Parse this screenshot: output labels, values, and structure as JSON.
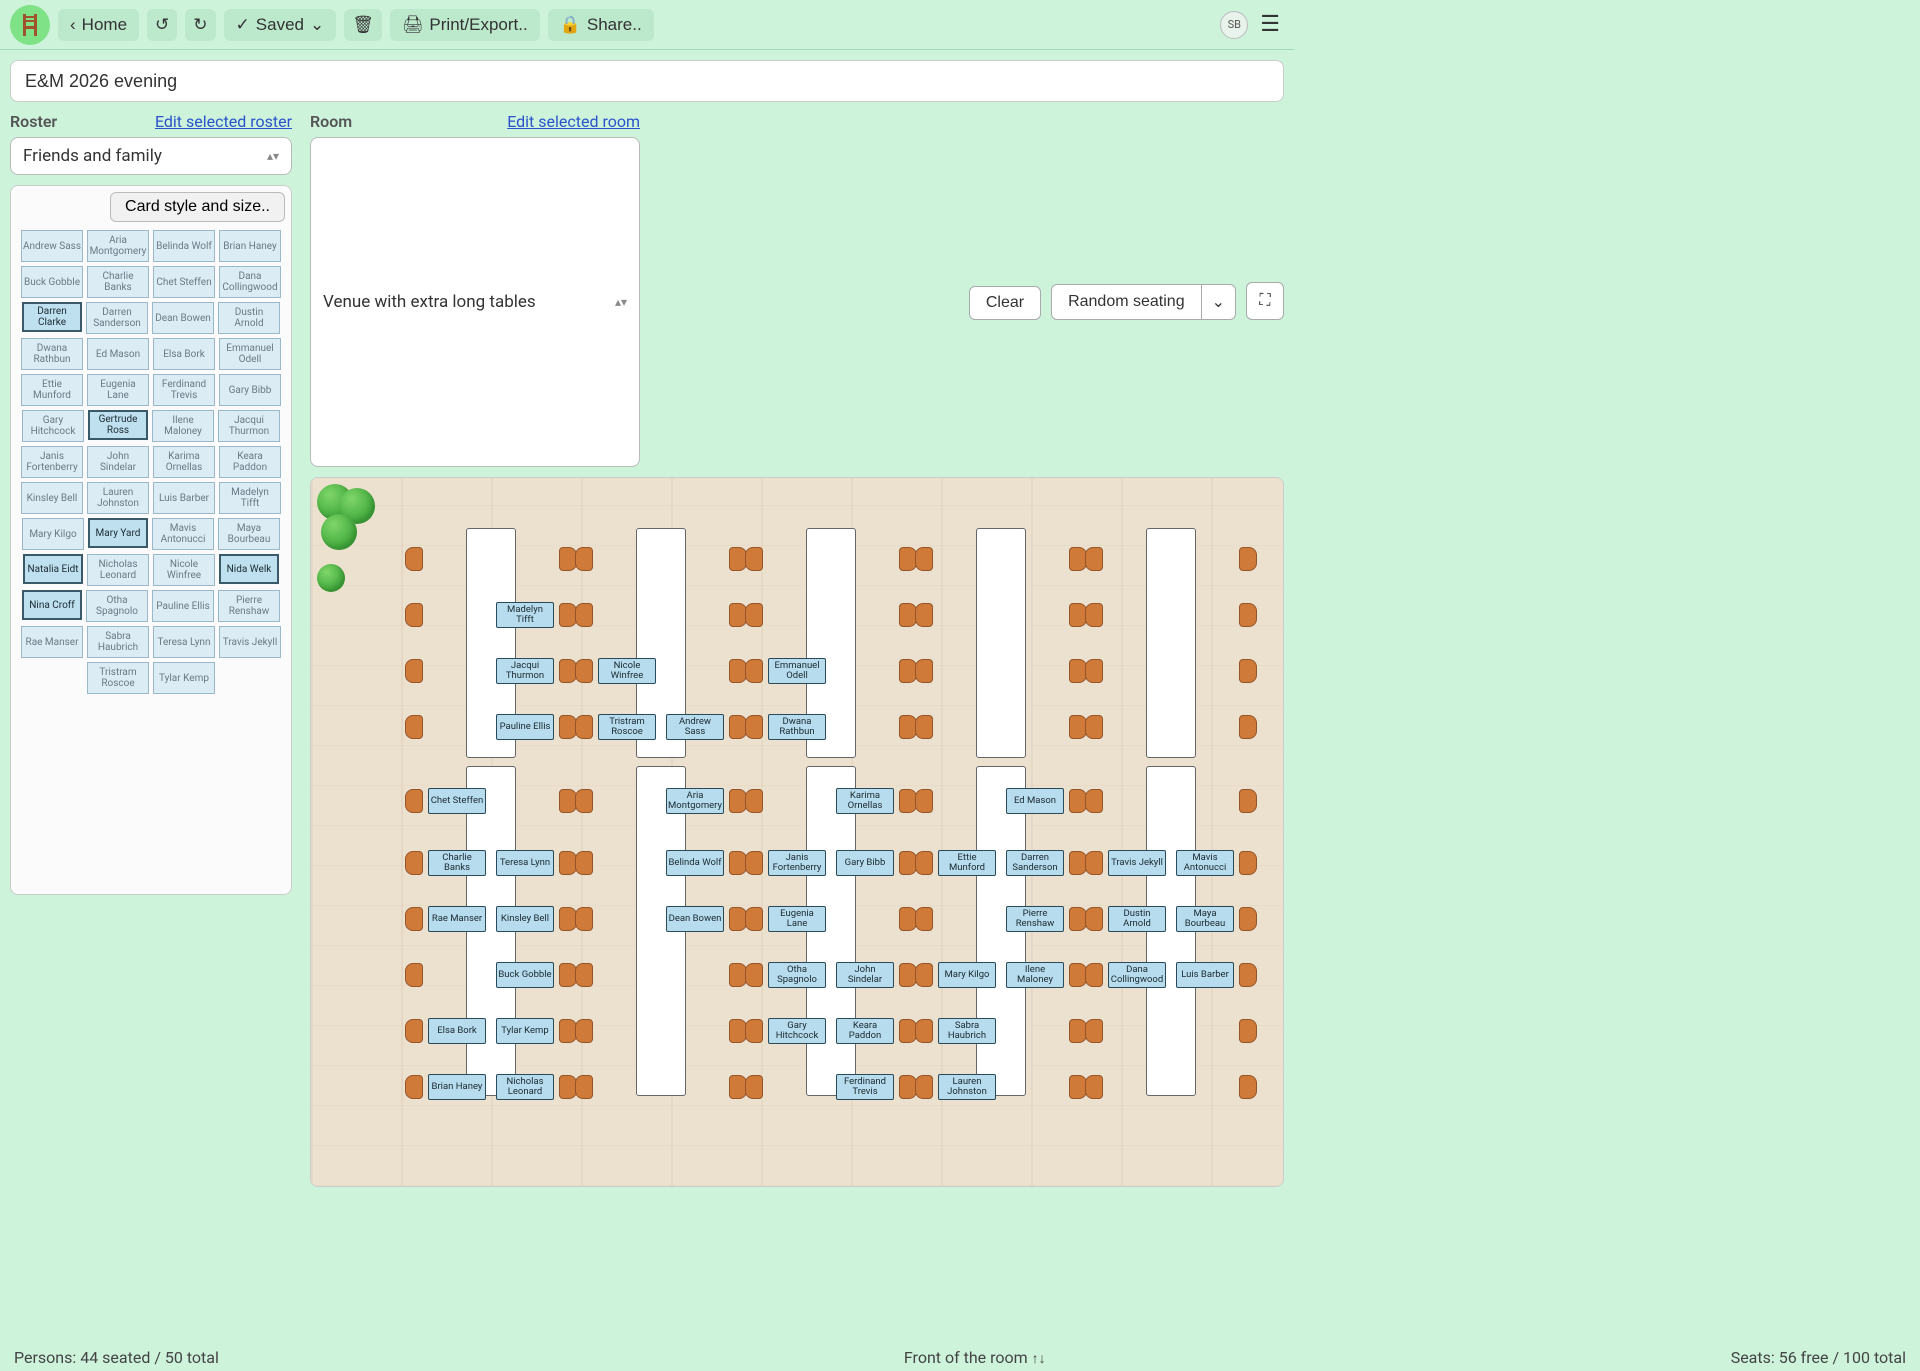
{
  "toolbar": {
    "home": "Home",
    "saved": "Saved",
    "print": "Print/Export..",
    "share": "Share..",
    "avatar": "SB"
  },
  "title": "E&M 2026 evening",
  "roster_label": "Roster",
  "roster_link": "Edit selected roster",
  "roster_selected": "Friends and family",
  "card_style_btn": "Card style and size..",
  "room_label": "Room",
  "room_link": "Edit selected room",
  "room_selected": "Venue with extra long tables",
  "clear_btn": "Clear",
  "random_btn": "Random seating",
  "roster": [
    {
      "name": "Andrew Sass",
      "seated": true
    },
    {
      "name": "Aria Montgomery",
      "seated": true
    },
    {
      "name": "Belinda Wolf",
      "seated": true
    },
    {
      "name": "Brian Haney",
      "seated": true
    },
    {
      "name": "Buck Gobble",
      "seated": true
    },
    {
      "name": "Charlie Banks",
      "seated": true
    },
    {
      "name": "Chet Steffen",
      "seated": true
    },
    {
      "name": "Dana Collingwood",
      "seated": true
    },
    {
      "name": "Darren Clarke",
      "seated": false
    },
    {
      "name": "Darren Sanderson",
      "seated": true
    },
    {
      "name": "Dean Bowen",
      "seated": true
    },
    {
      "name": "Dustin Arnold",
      "seated": true
    },
    {
      "name": "Dwana Rathbun",
      "seated": true
    },
    {
      "name": "Ed Mason",
      "seated": true
    },
    {
      "name": "Elsa Bork",
      "seated": true
    },
    {
      "name": "Emmanuel Odell",
      "seated": true
    },
    {
      "name": "Ettie Munford",
      "seated": true
    },
    {
      "name": "Eugenia Lane",
      "seated": true
    },
    {
      "name": "Ferdinand Trevis",
      "seated": true
    },
    {
      "name": "Gary Bibb",
      "seated": true
    },
    {
      "name": "Gary Hitchcock",
      "seated": true
    },
    {
      "name": "Gertrude Ross",
      "seated": false
    },
    {
      "name": "Ilene Maloney",
      "seated": true
    },
    {
      "name": "Jacqui Thurmon",
      "seated": true
    },
    {
      "name": "Janis Fortenberry",
      "seated": true
    },
    {
      "name": "John Sindelar",
      "seated": true
    },
    {
      "name": "Karima Ornellas",
      "seated": true
    },
    {
      "name": "Keara Paddon",
      "seated": true
    },
    {
      "name": "Kinsley Bell",
      "seated": true
    },
    {
      "name": "Lauren Johnston",
      "seated": true
    },
    {
      "name": "Luis Barber",
      "seated": true
    },
    {
      "name": "Madelyn Tifft",
      "seated": true
    },
    {
      "name": "Mary Kilgo",
      "seated": true
    },
    {
      "name": "Mary Yard",
      "seated": false
    },
    {
      "name": "Mavis Antonucci",
      "seated": true
    },
    {
      "name": "Maya Bourbeau",
      "seated": true
    },
    {
      "name": "Natalia Eidt",
      "seated": false
    },
    {
      "name": "Nicholas Leonard",
      "seated": true
    },
    {
      "name": "Nicole Winfree",
      "seated": true
    },
    {
      "name": "Nida Welk",
      "seated": false
    },
    {
      "name": "Nina Croff",
      "seated": false
    },
    {
      "name": "Otha Spagnolo",
      "seated": true
    },
    {
      "name": "Pauline Ellis",
      "seated": true
    },
    {
      "name": "Pierre Renshaw",
      "seated": true
    },
    {
      "name": "Rae Manser",
      "seated": true
    },
    {
      "name": "Sabra Haubrich",
      "seated": true
    },
    {
      "name": "Teresa Lynn",
      "seated": true
    },
    {
      "name": "Travis Jekyll",
      "seated": true
    },
    {
      "name": "Tristram Roscoe",
      "seated": true
    },
    {
      "name": "Tylar Kemp",
      "seated": true
    }
  ],
  "tables": [
    {
      "seats": [
        {
          "left": null,
          "right": null
        },
        {
          "left": null,
          "right": "Madelyn Tifft"
        },
        {
          "left": null,
          "right": "Jacqui Thurmon"
        },
        {
          "left": null,
          "right": "Pauline Ellis"
        },
        {
          "left": "Chet Steffen",
          "right": null
        },
        {
          "left": "Charlie Banks",
          "right": "Teresa Lynn"
        },
        {
          "left": "Rae Manser",
          "right": "Kinsley Bell"
        },
        {
          "left": null,
          "right": "Buck Gobble"
        },
        {
          "left": "Elsa Bork",
          "right": "Tylar Kemp"
        },
        {
          "left": "Brian Haney",
          "right": "Nicholas Leonard"
        }
      ]
    },
    {
      "seats": [
        {
          "left": null,
          "right": null
        },
        {
          "left": null,
          "right": null
        },
        {
          "left": "Nicole Winfree",
          "right": null
        },
        {
          "left": "Tristram Roscoe",
          "right": "Andrew Sass"
        },
        {
          "left": null,
          "right": "Aria Montgomery"
        },
        {
          "left": null,
          "right": "Belinda Wolf"
        },
        {
          "left": null,
          "right": "Dean Bowen"
        },
        {
          "left": null,
          "right": null
        },
        {
          "left": null,
          "right": null
        },
        {
          "left": null,
          "right": null
        }
      ]
    },
    {
      "seats": [
        {
          "left": null,
          "right": null
        },
        {
          "left": null,
          "right": null
        },
        {
          "left": "Emmanuel Odell",
          "right": null
        },
        {
          "left": "Dwana Rathbun",
          "right": null
        },
        {
          "left": null,
          "right": "Karima Ornellas"
        },
        {
          "left": "Janis Fortenberry",
          "right": "Gary Bibb"
        },
        {
          "left": "Eugenia Lane",
          "right": null
        },
        {
          "left": "Otha Spagnolo",
          "right": "John Sindelar"
        },
        {
          "left": "Gary Hitchcock",
          "right": "Keara Paddon"
        },
        {
          "left": null,
          "right": "Ferdinand Trevis"
        }
      ]
    },
    {
      "seats": [
        {
          "left": null,
          "right": null
        },
        {
          "left": null,
          "right": null
        },
        {
          "left": null,
          "right": null
        },
        {
          "left": null,
          "right": null
        },
        {
          "left": null,
          "right": "Ed Mason"
        },
        {
          "left": "Ettie Munford",
          "right": "Darren Sanderson"
        },
        {
          "left": null,
          "right": "Pierre Renshaw"
        },
        {
          "left": "Mary Kilgo",
          "right": "Ilene Maloney"
        },
        {
          "left": "Sabra Haubrich",
          "right": null
        },
        {
          "left": "Lauren Johnston",
          "right": null
        }
      ]
    },
    {
      "seats": [
        {
          "left": null,
          "right": null
        },
        {
          "left": null,
          "right": null
        },
        {
          "left": null,
          "right": null
        },
        {
          "left": null,
          "right": null
        },
        {
          "left": null,
          "right": null
        },
        {
          "left": "Travis Jekyll",
          "right": "Mavis Antonucci"
        },
        {
          "left": "Dustin Arnold",
          "right": "Maya Bourbeau"
        },
        {
          "left": "Dana Collingwood",
          "right": "Luis Barber"
        },
        {
          "left": null,
          "right": null
        },
        {
          "left": null,
          "right": null
        }
      ]
    }
  ],
  "footer": {
    "persons_label": "Persons:",
    "persons_value": "44 seated / 50 total",
    "front_label": "Front of the room",
    "seats_label": "Seats:",
    "seats_value": "56 free / 100 total"
  }
}
